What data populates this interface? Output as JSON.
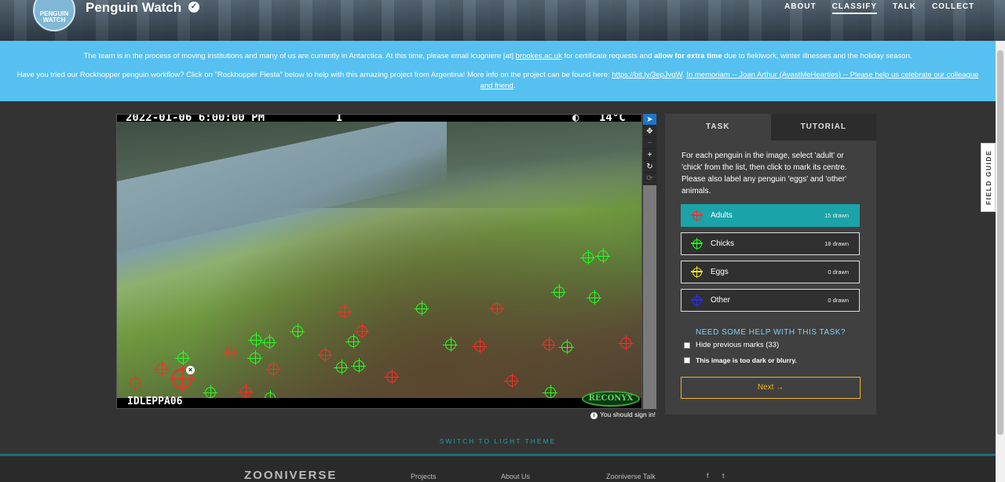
{
  "header": {
    "logo_text": "PENGUIN WATCH",
    "title": "Penguin Watch",
    "nav": [
      "ABOUT",
      "CLASSIFY",
      "TALK",
      "COLLECT"
    ],
    "active_nav": "CLASSIFY"
  },
  "announcement": {
    "line1_a": "The team is in the process of moving institutions and many of us are currently in Antarctica. At this time, please email lcugniere [at] ",
    "line1_link": "brookes.ac.uk",
    "line1_b": " for certificate requests and ",
    "line1_bold": "allow for extra time",
    "line1_c": " due to fieldwork, winter illnesses and the holiday season.",
    "line2_a": "Have you tried our Rockhopper penguin workflow? Click on \"Rockhopper Fiesta\" below to help with this amazing project from Argentina! More info on the project can be found here: ",
    "line2_link1": "https://bit.ly/3epJvgW",
    "line2_b": ". ",
    "line2_link2": "In memoriam -- Joan Arthur (AvastMeHearties) -- Please help us celebrate our colleague and friend",
    "line2_c": "."
  },
  "subject": {
    "timestamp": "2022-01-06 6:00:00 PM",
    "moon": "◐",
    "temperature": "14°C",
    "camera_id": "IDLEPPA06",
    "brand": "RECONYX"
  },
  "tools": [
    "pointer-tool",
    "pan-tool",
    "zoom-out-tool",
    "zoom-in-tool",
    "rotate-tool",
    "reset-tool"
  ],
  "sign_in_notice": "You should sign in!",
  "task": {
    "tabs": [
      "TASK",
      "TUTORIAL"
    ],
    "instructions": "For each penguin in the image, select 'adult' or 'chick' from the list, then click to mark its centre. Please also label any penguin 'eggs' and 'other' animals.",
    "answers": [
      {
        "label": "Adults",
        "count": "15 drawn",
        "color": "#ff2a2a"
      },
      {
        "label": "Chicks",
        "count": "18 drawn",
        "color": "#22ff22"
      },
      {
        "label": "Eggs",
        "count": "0 drawn",
        "color": "#f3e51d"
      },
      {
        "label": "Other",
        "count": "0 drawn",
        "color": "#2a2aff"
      }
    ],
    "help_title": "NEED SOME HELP WITH THIS TASK?",
    "hide_marks_label": "Hide previous marks (33)",
    "dark_label": "This image is too dark or blurry.",
    "next_label": "Next →"
  },
  "field_guide_label": "FIELD GUIDE",
  "theme_switch_label": "SWITCH TO LIGHT THEME",
  "footer": {
    "brand": "ZOONIVERSE",
    "links": [
      "Projects",
      "About Us",
      "Zooniverse Talk"
    ],
    "social": [
      "f",
      "t"
    ]
  },
  "colors": {
    "accent_teal": "#1aa3a8",
    "next_gold": "#f0b325",
    "banner_blue": "#56c0f0"
  }
}
